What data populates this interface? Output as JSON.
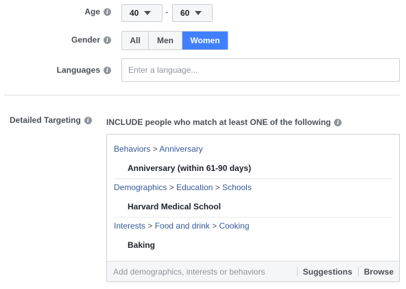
{
  "age": {
    "label": "Age",
    "min": "40",
    "max": "60",
    "separator": "-"
  },
  "gender": {
    "label": "Gender",
    "options": [
      "All",
      "Men",
      "Women"
    ],
    "selected": "Women"
  },
  "languages": {
    "label": "Languages",
    "placeholder": "Enter a language..."
  },
  "detailed_targeting": {
    "label": "Detailed Targeting",
    "include_text": "INCLUDE people who match at least ONE of the following",
    "groups": [
      {
        "path": [
          "Behaviors",
          "Anniversary"
        ],
        "value": "Anniversary (within 61-90 days)"
      },
      {
        "path": [
          "Demographics",
          "Education",
          "Schools"
        ],
        "value": "Harvard Medical School"
      },
      {
        "path": [
          "Interests",
          "Food and drink",
          "Cooking"
        ],
        "value": "Baking"
      }
    ],
    "path_separator": ">",
    "input_placeholder": "Add demographics, interests or behaviors",
    "suggestions_label": "Suggestions",
    "browse_label": "Browse"
  },
  "colors": {
    "accent": "#4080ff",
    "link": "#365899",
    "info_icon": "#90949c"
  },
  "icons": {
    "info": "info-icon",
    "dropdown": "caret-down-icon"
  }
}
